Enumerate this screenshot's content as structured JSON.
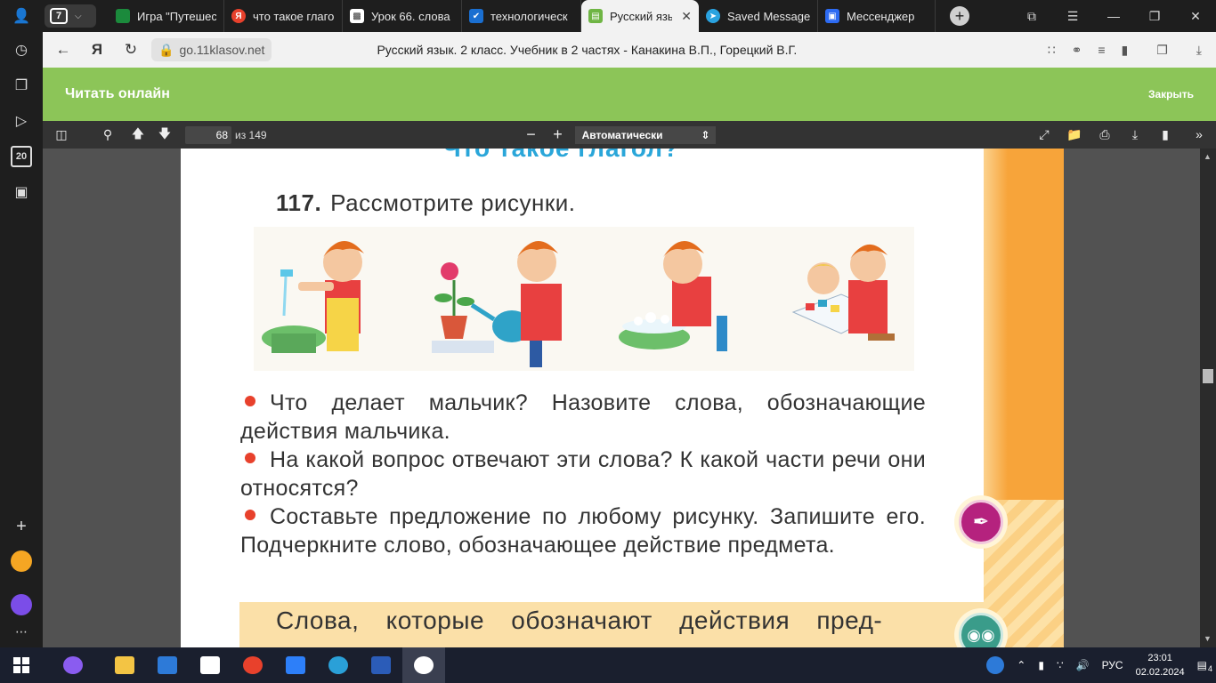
{
  "browser": {
    "tab_count": "7",
    "tabs": [
      {
        "title": "Игра \"Путешес",
        "color": "#1b8a3c",
        "glyph": "⬚"
      },
      {
        "title": "что такое глаго",
        "color": "#e8412c",
        "glyph": "Я"
      },
      {
        "title": "Урок 66. слова",
        "color": "#ffffff",
        "glyph": "◩"
      },
      {
        "title": "технологическ",
        "color": "#1a6fd1",
        "glyph": "✔"
      },
      {
        "title": "Русский язык",
        "color": "#6fb544",
        "glyph": "▥"
      },
      {
        "title": "Saved Message",
        "color": "#2aa3e0",
        "glyph": "➤"
      },
      {
        "title": "Мессенджер",
        "color": "#2d6bf2",
        "glyph": "▣"
      }
    ],
    "active_tab_index": 4,
    "url": "go.11klasov.net",
    "page_title": "Русский язык. 2 класс. Учебник в 2 частях - Канакина В.П., Горецкий В.Г."
  },
  "reader": {
    "title": "Читать онлайн",
    "close_label": "Закрыть"
  },
  "pdf_toolbar": {
    "current_page": "68",
    "total_pages": "из 149",
    "zoom": "Автоматически"
  },
  "page": {
    "heading": "Что такое глагол?",
    "exercise_number": "117.",
    "exercise_text": "Рассмотрите рисунки.",
    "bullets": [
      "Что делает мальчик? Назовите слова, обозначающие действия мальчика.",
      "На какой вопрос отвечают эти слова? К какой части речи они относятся?",
      "Составьте предложение по любому рисунку. Запишите его. Подчеркните слово, обозначающее действие предмета."
    ],
    "rule_text": "Слова, которые обозначают действия пред-"
  },
  "taskbar": {
    "language": "РУС",
    "time": "23:01",
    "date": "02.02.2024",
    "notifications": "4"
  }
}
